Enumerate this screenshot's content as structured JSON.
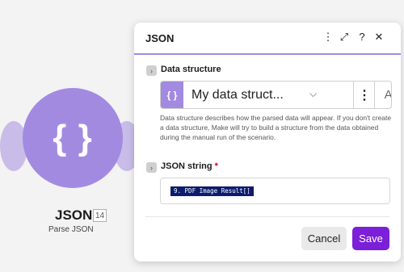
{
  "node": {
    "icon": "{ }",
    "title": "JSON",
    "badge": "14",
    "subtitle": "Parse JSON"
  },
  "panel": {
    "title": "JSON",
    "header_icons": [
      "more-vertical-icon",
      "expand-icon",
      "help-icon",
      "close-icon"
    ],
    "header_glyphs": {
      "more": "⋮",
      "expand": "⤢",
      "help": "?",
      "close": "✕"
    }
  },
  "data_structure": {
    "label": "Data structure",
    "icon": "{ }",
    "selected_value": "My data struct...",
    "menu_glyph": "⋮",
    "add_label": "Add",
    "help_text": "Data structure describes how the parsed data will appear. If you don't create a data structure, Make will try to build a structure from the data obtained during the manual run of the scenario."
  },
  "json_string": {
    "label": "JSON string",
    "required_mark": "*",
    "value_pill": "9. PDF Image Result[]"
  },
  "footer": {
    "cancel_label": "Cancel",
    "save_label": "Save"
  },
  "colors": {
    "accent": "#a38ae1",
    "save_button": "#7b1fd8",
    "pill_bg": "#0d1b6e"
  }
}
